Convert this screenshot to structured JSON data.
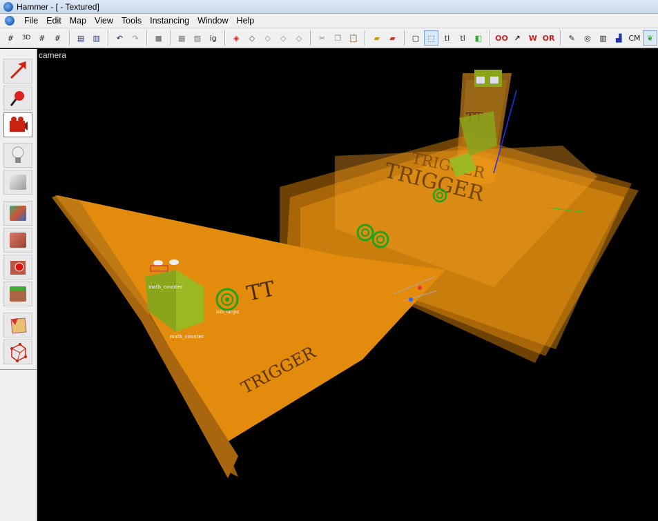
{
  "window": {
    "title": "Hammer - [ - Textured]"
  },
  "menu": [
    "File",
    "Edit",
    "Map",
    "View",
    "Tools",
    "Instancing",
    "Window",
    "Help"
  ],
  "toolbar": {
    "items": [
      "grid",
      "3d-grid",
      "grid-smaller",
      "grid-larger",
      "sep",
      "carve",
      "group",
      "sep",
      "undo",
      "redo",
      "sep",
      "texture-lock",
      "hide",
      "show",
      "ig",
      "sep",
      "sel-a",
      "sel-b",
      "sel-c",
      "sel-d",
      "sel-e",
      "sep",
      "cut",
      "copy",
      "paste",
      "sep",
      "hazard",
      "hazard-b",
      "sep",
      "bbox",
      "lasso",
      "tl",
      "tt",
      "flip",
      "sep",
      "OO",
      "N",
      "W",
      "OR",
      "sep",
      "clip",
      "sphere",
      "tex",
      "pin",
      "CM",
      "leaf"
    ],
    "labels": {
      "tl": "tl",
      "tt": "tl",
      "cm": "CM",
      "ig": "ig"
    }
  },
  "left_tools": [
    {
      "name": "selection-tool",
      "color": "#c21"
    },
    {
      "name": "magnify-tool",
      "color": "#c21"
    },
    {
      "name": "camera-tool",
      "color": "#c21",
      "selected": true
    },
    {
      "name": "entity-tool",
      "color": "#ddd"
    },
    {
      "name": "block-tool",
      "color": "#ccc"
    },
    {
      "name": "texture-application-tool",
      "color": "#6a4"
    },
    {
      "name": "apply-current-texture-tool",
      "color": "#b54"
    },
    {
      "name": "decal-tool",
      "color": "#b54"
    },
    {
      "name": "overlay-tool",
      "color": "#5a3"
    },
    {
      "name": "clipping-tool",
      "color": "#e8c070"
    },
    {
      "name": "vertex-tool",
      "color": "#c21"
    }
  ],
  "viewport": {
    "label": "camera",
    "entities": [
      {
        "label": "math_counter"
      },
      {
        "label": "math_counter"
      },
      {
        "label": "info_target"
      }
    ],
    "brush_texts": [
      "TRIGGER",
      "TRIGGER",
      "TRIGGER",
      "TT",
      "TT"
    ]
  }
}
